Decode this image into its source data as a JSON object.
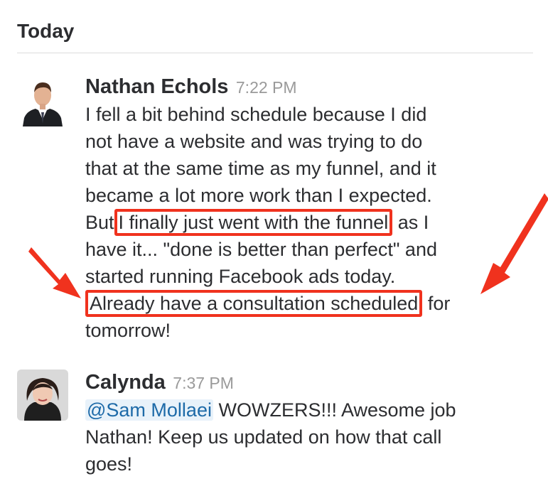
{
  "day_header": "Today",
  "messages": [
    {
      "sender": "Nathan Echols",
      "time": "7:22 PM",
      "lines": {
        "l1": "I fell a bit behind schedule because I did",
        "l2": "not have a website and was trying to do",
        "l3": "that at the same time as my funnel, and it",
        "l4": "became a lot more work than I expected.",
        "l5_pre": "But",
        "l5_hl": "I finally just went with the funnel",
        "l5_post": "as I",
        "l6": "have it... \"done is better than perfect\" and",
        "l7": "started running Facebook ads today.",
        "l8_hl": "Already have a consultation scheduled",
        "l8_post": "for",
        "l9": "tomorrow!"
      }
    },
    {
      "sender": "Calynda",
      "time": "7:37 PM",
      "lines": {
        "mention": "@Sam Mollaei",
        "l1_post": "WOWZERS!!! Awesome job",
        "l2": "Nathan! Keep us updated on how that call",
        "l3": "goes!"
      }
    }
  ],
  "colors": {
    "highlight": "#f0321e",
    "mention_bg": "#e8f2fa",
    "mention_text": "#1d6aa8",
    "timestamp": "#9a9a9a"
  },
  "icons": {
    "annotation_left": "red-arrow-icon",
    "annotation_right": "red-arrow-icon"
  }
}
